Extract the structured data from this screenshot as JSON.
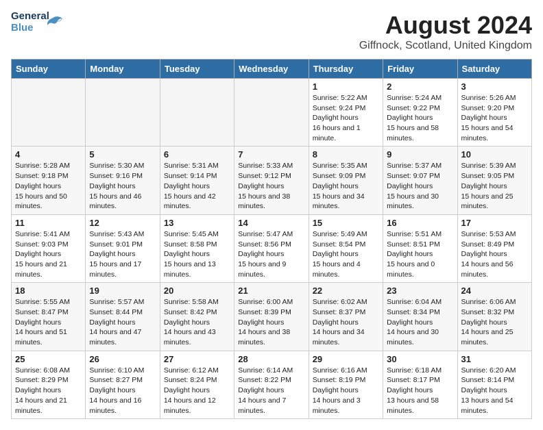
{
  "logo": {
    "general": "General",
    "blue": "Blue"
  },
  "title": "August 2024",
  "location": "Giffnock, Scotland, United Kingdom",
  "days_of_week": [
    "Sunday",
    "Monday",
    "Tuesday",
    "Wednesday",
    "Thursday",
    "Friday",
    "Saturday"
  ],
  "weeks": [
    {
      "cells": [
        {
          "day": "",
          "empty": true
        },
        {
          "day": "",
          "empty": true
        },
        {
          "day": "",
          "empty": true
        },
        {
          "day": "",
          "empty": true
        },
        {
          "day": "1",
          "sunrise": "5:22 AM",
          "sunset": "9:24 PM",
          "daylight": "16 hours and 1 minute."
        },
        {
          "day": "2",
          "sunrise": "5:24 AM",
          "sunset": "9:22 PM",
          "daylight": "15 hours and 58 minutes."
        },
        {
          "day": "3",
          "sunrise": "5:26 AM",
          "sunset": "9:20 PM",
          "daylight": "15 hours and 54 minutes."
        }
      ]
    },
    {
      "cells": [
        {
          "day": "4",
          "sunrise": "5:28 AM",
          "sunset": "9:18 PM",
          "daylight": "15 hours and 50 minutes."
        },
        {
          "day": "5",
          "sunrise": "5:30 AM",
          "sunset": "9:16 PM",
          "daylight": "15 hours and 46 minutes."
        },
        {
          "day": "6",
          "sunrise": "5:31 AM",
          "sunset": "9:14 PM",
          "daylight": "15 hours and 42 minutes."
        },
        {
          "day": "7",
          "sunrise": "5:33 AM",
          "sunset": "9:12 PM",
          "daylight": "15 hours and 38 minutes."
        },
        {
          "day": "8",
          "sunrise": "5:35 AM",
          "sunset": "9:09 PM",
          "daylight": "15 hours and 34 minutes."
        },
        {
          "day": "9",
          "sunrise": "5:37 AM",
          "sunset": "9:07 PM",
          "daylight": "15 hours and 30 minutes."
        },
        {
          "day": "10",
          "sunrise": "5:39 AM",
          "sunset": "9:05 PM",
          "daylight": "15 hours and 25 minutes."
        }
      ]
    },
    {
      "cells": [
        {
          "day": "11",
          "sunrise": "5:41 AM",
          "sunset": "9:03 PM",
          "daylight": "15 hours and 21 minutes."
        },
        {
          "day": "12",
          "sunrise": "5:43 AM",
          "sunset": "9:01 PM",
          "daylight": "15 hours and 17 minutes."
        },
        {
          "day": "13",
          "sunrise": "5:45 AM",
          "sunset": "8:58 PM",
          "daylight": "15 hours and 13 minutes."
        },
        {
          "day": "14",
          "sunrise": "5:47 AM",
          "sunset": "8:56 PM",
          "daylight": "15 hours and 9 minutes."
        },
        {
          "day": "15",
          "sunrise": "5:49 AM",
          "sunset": "8:54 PM",
          "daylight": "15 hours and 4 minutes."
        },
        {
          "day": "16",
          "sunrise": "5:51 AM",
          "sunset": "8:51 PM",
          "daylight": "15 hours and 0 minutes."
        },
        {
          "day": "17",
          "sunrise": "5:53 AM",
          "sunset": "8:49 PM",
          "daylight": "14 hours and 56 minutes."
        }
      ]
    },
    {
      "cells": [
        {
          "day": "18",
          "sunrise": "5:55 AM",
          "sunset": "8:47 PM",
          "daylight": "14 hours and 51 minutes."
        },
        {
          "day": "19",
          "sunrise": "5:57 AM",
          "sunset": "8:44 PM",
          "daylight": "14 hours and 47 minutes."
        },
        {
          "day": "20",
          "sunrise": "5:58 AM",
          "sunset": "8:42 PM",
          "daylight": "14 hours and 43 minutes."
        },
        {
          "day": "21",
          "sunrise": "6:00 AM",
          "sunset": "8:39 PM",
          "daylight": "14 hours and 38 minutes."
        },
        {
          "day": "22",
          "sunrise": "6:02 AM",
          "sunset": "8:37 PM",
          "daylight": "14 hours and 34 minutes."
        },
        {
          "day": "23",
          "sunrise": "6:04 AM",
          "sunset": "8:34 PM",
          "daylight": "14 hours and 30 minutes."
        },
        {
          "day": "24",
          "sunrise": "6:06 AM",
          "sunset": "8:32 PM",
          "daylight": "14 hours and 25 minutes."
        }
      ]
    },
    {
      "cells": [
        {
          "day": "25",
          "sunrise": "6:08 AM",
          "sunset": "8:29 PM",
          "daylight": "14 hours and 21 minutes."
        },
        {
          "day": "26",
          "sunrise": "6:10 AM",
          "sunset": "8:27 PM",
          "daylight": "14 hours and 16 minutes."
        },
        {
          "day": "27",
          "sunrise": "6:12 AM",
          "sunset": "8:24 PM",
          "daylight": "14 hours and 12 minutes."
        },
        {
          "day": "28",
          "sunrise": "6:14 AM",
          "sunset": "8:22 PM",
          "daylight": "14 hours and 7 minutes."
        },
        {
          "day": "29",
          "sunrise": "6:16 AM",
          "sunset": "8:19 PM",
          "daylight": "14 hours and 3 minutes."
        },
        {
          "day": "30",
          "sunrise": "6:18 AM",
          "sunset": "8:17 PM",
          "daylight": "13 hours and 58 minutes."
        },
        {
          "day": "31",
          "sunrise": "6:20 AM",
          "sunset": "8:14 PM",
          "daylight": "13 hours and 54 minutes."
        }
      ]
    }
  ],
  "labels": {
    "sunrise_prefix": "Sunrise: ",
    "sunset_prefix": "Sunset: ",
    "daylight_prefix": "Daylight: "
  }
}
